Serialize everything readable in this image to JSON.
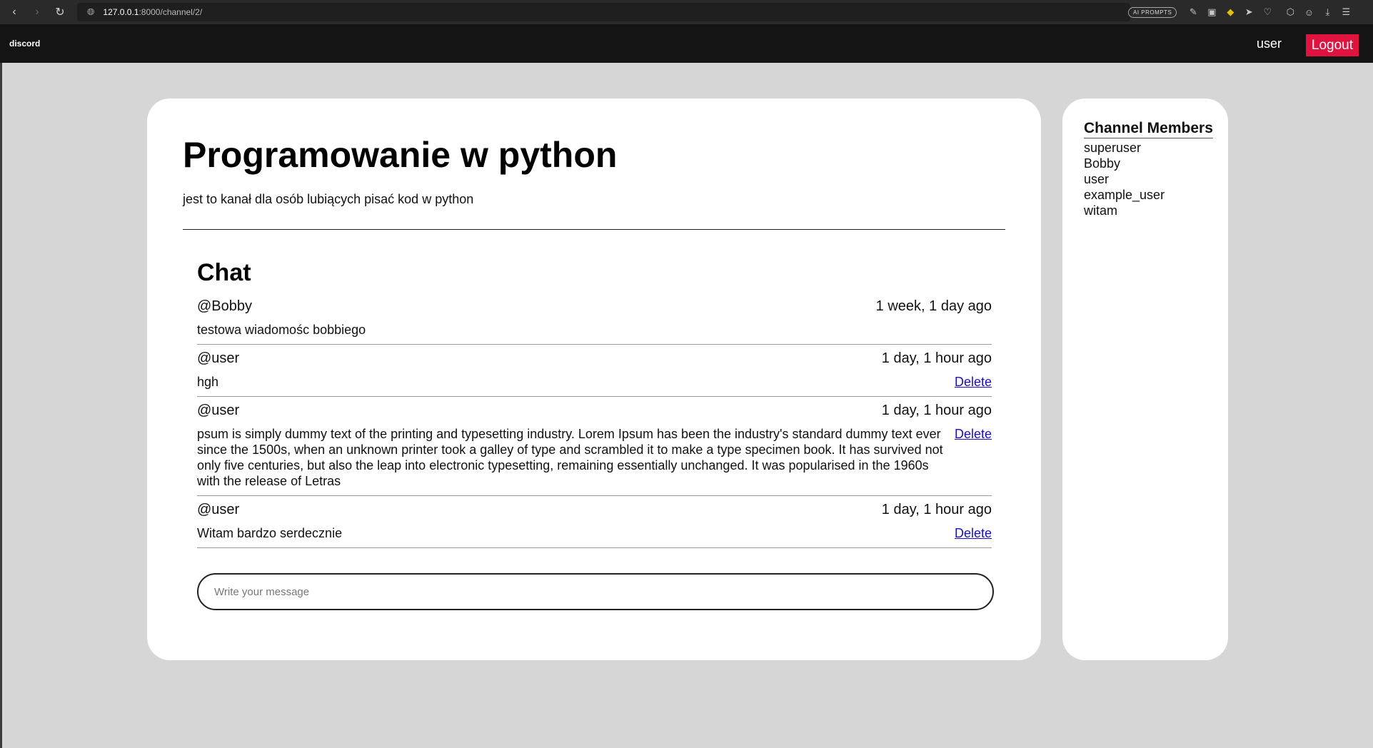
{
  "browser": {
    "url_host": "127.0.0.1",
    "url_path": ":8000/channel/2/",
    "ai_prompts_label": "AI PROMPTS"
  },
  "navbar": {
    "brand": "discord",
    "username": "user",
    "logout_label": "Logout"
  },
  "channel": {
    "title": "Programowanie w python",
    "description": "jest to kanał dla osób lubiących pisać kod w python"
  },
  "chat": {
    "title": "Chat",
    "delete_label": "Delete",
    "messages": [
      {
        "author": "@Bobby",
        "time": "1 week, 1 day ago",
        "text": "testowa wiadomośc bobbiego",
        "can_delete": false
      },
      {
        "author": "@user",
        "time": "1 day, 1 hour ago",
        "text": "hgh",
        "can_delete": true
      },
      {
        "author": "@user",
        "time": "1 day, 1 hour ago",
        "text": "psum is simply dummy text of the printing and typesetting industry. Lorem Ipsum has been the industry's standard dummy text ever since the 1500s, when an unknown printer took a galley of type and scrambled it to make a type specimen book. It has survived not only five centuries, but also the leap into electronic typesetting, remaining essentially unchanged. It was popularised in the 1960s with the release of Letras",
        "can_delete": true
      },
      {
        "author": "@user",
        "time": "1 day, 1 hour ago",
        "text": "Witam bardzo serdecznie",
        "can_delete": true
      }
    ],
    "input_placeholder": "Write your message"
  },
  "members": {
    "title": "Channel Members",
    "list": [
      "superuser",
      "Bobby",
      "user",
      "example_user",
      "witam"
    ]
  },
  "colors": {
    "logout_bg": "#e0133f",
    "page_bg": "#d6d6d6",
    "navbar_bg": "#141414",
    "link": "#1a0dcc"
  }
}
